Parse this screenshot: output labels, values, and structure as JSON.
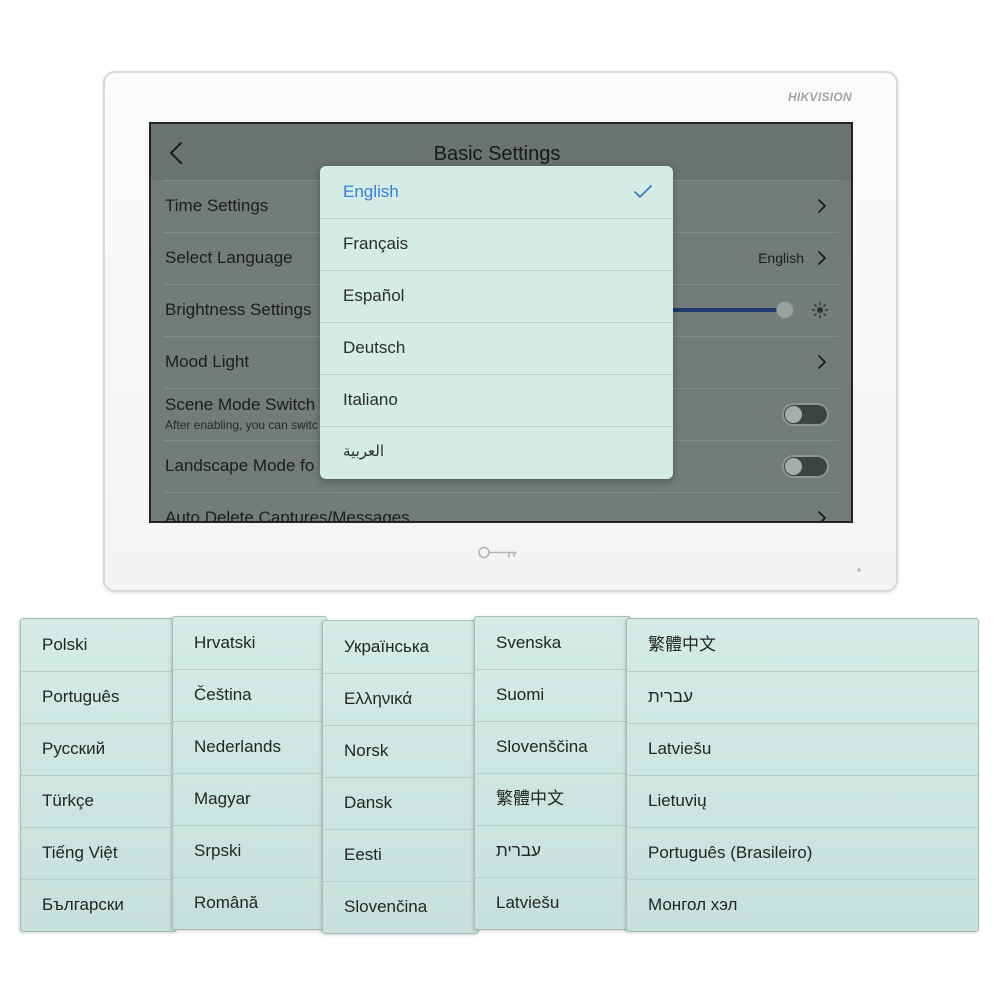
{
  "device": {
    "brand_logo": "HIKVISION",
    "unlock_icon": "key-icon",
    "indicator_icon": "indicator-light"
  },
  "settings": {
    "back_icon": "chevron-left-icon",
    "title": "Basic Settings",
    "rows": [
      {
        "label": "Time Settings",
        "icon": "chevron-right-icon"
      },
      {
        "label": "Select Language",
        "value": "English",
        "icon": "chevron-right-icon"
      },
      {
        "label": "Brightness Settings",
        "icon": "brightness-icon",
        "brightness_level": 0.98
      },
      {
        "label": "Mood Light",
        "icon": "chevron-right-icon"
      },
      {
        "label": "Scene Mode Switch",
        "description": "After enabling, you can switc",
        "toggle_on": false
      },
      {
        "label": "Landscape Mode fo",
        "toggle_on": false
      },
      {
        "label": "Auto Delete Captures/Messages",
        "icon": "chevron-right-icon"
      }
    ]
  },
  "language_dropdown": {
    "selected_index": 0,
    "check_icon": "checkmark-icon",
    "options": [
      "English",
      "Français",
      "Español",
      "Deutsch",
      "Italiano",
      "العربية"
    ]
  },
  "language_panels": [
    [
      "Polski",
      "Português",
      "Русский",
      "Türkçe",
      "Tiếng Việt",
      "Български"
    ],
    [
      "Hrvatski",
      "Čeština",
      "Nederlands",
      "Magyar",
      "Srpski",
      "Română"
    ],
    [
      "Українська",
      "Ελληνικά",
      "Norsk",
      "Dansk",
      "Eesti",
      "Slovenčina"
    ],
    [
      "Svenska",
      "Suomi",
      "Slovenščina",
      "繁體中文",
      "עברית",
      "Latviešu"
    ],
    [
      "繁體中文",
      "עברית",
      "Latviešu",
      "Lietuvių",
      "Português (Brasileiro)",
      "Монгол хэл"
    ]
  ],
  "colors": {
    "accent": "#3a7fd5",
    "slider_fill": "#1e3c6e",
    "panel_bg": "#d4ebe6",
    "dimmed_screen": "#737c76"
  }
}
